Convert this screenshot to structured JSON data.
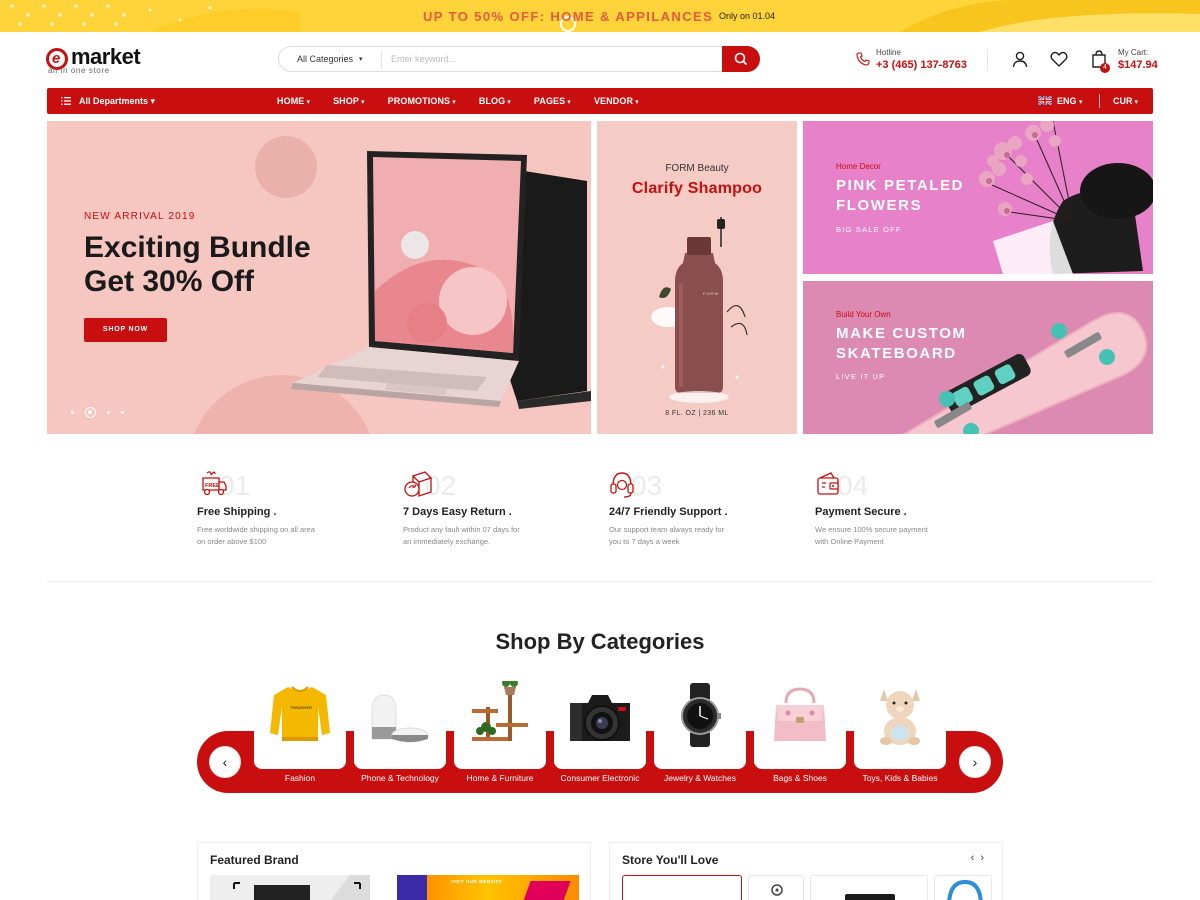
{
  "promo": {
    "text": "UP TO 50% OFF: HOME & APPILANCES",
    "date": "Only on 01.04"
  },
  "logo": {
    "icon_letter": "e",
    "name": "market",
    "tagline": "all in one store"
  },
  "search": {
    "category": "All Categories",
    "placeholder": "Enter keyword...",
    "button_icon": "search-icon"
  },
  "hotline": {
    "label": "Hotline",
    "number": "+3 (465) 137-8763"
  },
  "cart": {
    "label": "My Cart:",
    "total": "$147.94",
    "count": "4"
  },
  "nav": {
    "departments": "All Departments",
    "items": [
      "HOME",
      "SHOP",
      "PROMOTIONS",
      "BLOG",
      "PAGES",
      "VENDOR"
    ],
    "language": "ENG",
    "currency": "CUR"
  },
  "hero": {
    "main": {
      "eyebrow": "NEW ARRIVAL 2019",
      "title": "Exciting Bundle\nGet 30% Off",
      "button": "SHOP NOW",
      "slides": 4,
      "active_slide": 2
    },
    "middle": {
      "brand": "FORM Beauty",
      "title": "Clarify Shampoo",
      "size": "8 FL. OZ  |  236 ML",
      "bottle_text": "FORM"
    },
    "right_top": {
      "eyebrow": "Home Decor",
      "title": "PINK PETALED\nFLOWERS",
      "sub": "BIG SALE OFF"
    },
    "right_bottom": {
      "eyebrow": "Build Your Own",
      "title": "MAKE CUSTOM\nSKATEBOARD",
      "sub": "LIVE IT UP"
    }
  },
  "features": [
    {
      "num": "01",
      "title": "Free Shipping .",
      "desc": "Free worldwide shipping on all area on order above $100",
      "icon": "free-truck-icon"
    },
    {
      "num": "02",
      "title": "7 Days Easy Return .",
      "desc": "Product any fault within 07 days for an immediately exchange.",
      "icon": "return-box-icon"
    },
    {
      "num": "03",
      "title": "24/7 Friendly Support .",
      "desc": "Our support team always ready for you to 7 days a week",
      "icon": "headset-icon"
    },
    {
      "num": "04",
      "title": "Payment Secure .",
      "desc": "We ensure 100% secure payment with Online Payment",
      "icon": "secure-wallet-icon"
    }
  ],
  "categories": {
    "heading": "Shop By Categories",
    "items": [
      "Fashion",
      "Phone & Technology",
      "Home & Furniture",
      "Consumer Electronic",
      "Jewelry & Watches",
      "Bags & Shoes",
      "Toys, Kids & Babies"
    ]
  },
  "panels": {
    "featured": "Featured Brand",
    "store": "Store You'll Love",
    "featured_banner_text": "VISIT OUR WEBSITE"
  },
  "colors": {
    "brand": "#c80e0e",
    "promo": "#ffd43b",
    "hero_pink": "#f6c6c1",
    "flowers": "#e781c9",
    "skate": "#dc8ab2"
  }
}
